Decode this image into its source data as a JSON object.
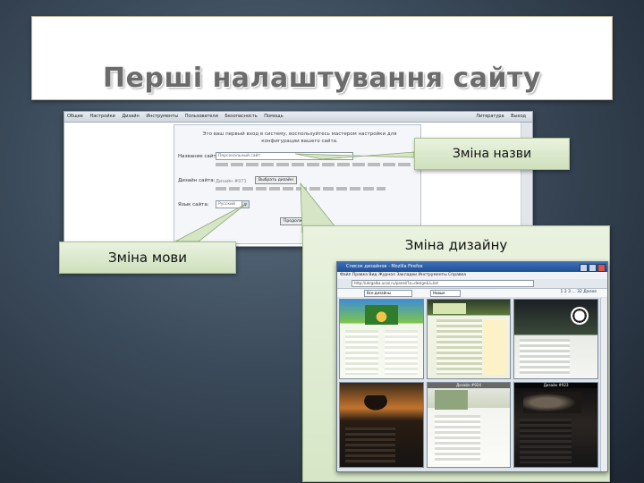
{
  "slide": {
    "title": "Перші налаштування сайту",
    "callouts": {
      "name": "Зміна назви",
      "language": "Зміна мови",
      "design": "Зміна дизайну"
    }
  },
  "settings_screenshot": {
    "menu_left": [
      "Общее",
      "Настройки",
      "Дизайн",
      "Инструменты",
      "Пользователи",
      "Безопасность",
      "Помощь"
    ],
    "menu_right": [
      "Литература",
      "Выход"
    ],
    "intro": "Это ваш первый вход в систему, воспользуйтесь мастером настройки для конфигурации вашего сайта.",
    "site_name_label": "Название сайта:",
    "site_name_value": "Персональный сайт",
    "design_label": "Дизайн сайта:",
    "design_value": "Дизайн #971",
    "choose_button": "Выбрать дизайн",
    "language_label": "Язык сайта:",
    "language_value": "Русский",
    "continue_button": "Продолжить"
  },
  "browser_screenshot": {
    "window_title": "Список дизайнов - Mozilla Firefox",
    "menu": "Файл Правка Вид Журнал Закладки Инструменты Справка",
    "url": "http://ukrgalka.ucoz.ru/panel/?a=design&l=list",
    "filter_select": "Все дизайны",
    "sort_select": "Новые",
    "pager": "1 2 3 ... 32 Далее",
    "thumb_captions": [
      "",
      "",
      "",
      "Дизайн #924",
      "",
      "Дизайн #923"
    ]
  }
}
